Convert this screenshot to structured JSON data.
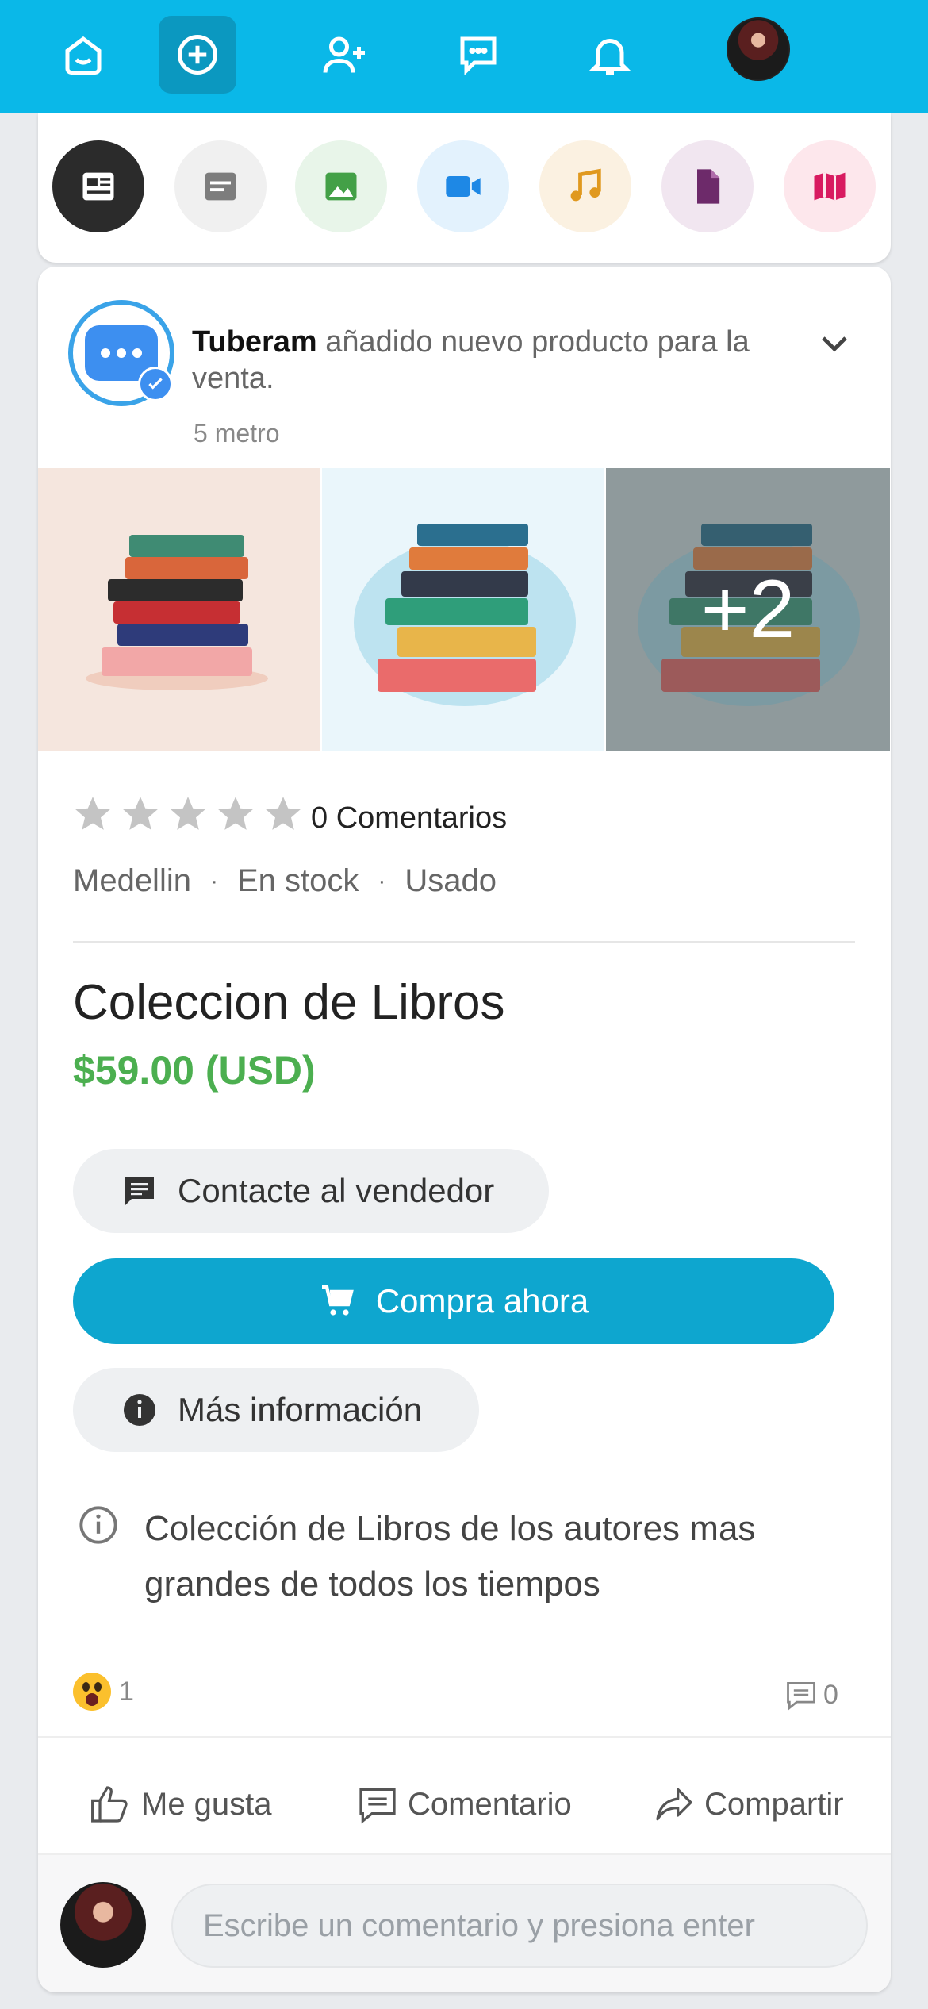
{
  "colors": {
    "topbar": "#0ab8e8",
    "accent": "#0ea6cf",
    "price": "#4caf50"
  },
  "nav": {
    "items": [
      "home-icon",
      "add-post-icon",
      "add-friend-icon",
      "messages-icon",
      "notifications-icon"
    ],
    "active": "add-post-icon"
  },
  "post_types": [
    "news-feed-icon",
    "text-post-icon",
    "image-icon",
    "video-icon",
    "music-icon",
    "document-icon",
    "map-icon"
  ],
  "post": {
    "author": "Tuberam",
    "action_text": " añadido nuevo producto para la venta.",
    "time": "5 metro",
    "more_images": "+2",
    "rating": {
      "stars": 0,
      "max": 5
    },
    "reviews_label": "0 Comentarios",
    "location": "Medellin",
    "stock": "En stock",
    "condition": "Usado",
    "separator": "·",
    "title": "Coleccion de Libros",
    "price": "$59.00 (USD)",
    "contact_label": "Contacte al vendedor",
    "buy_label": "Compra ahora",
    "info_label": "Más información",
    "description": "Colección de Libros de los autores mas grandes de todos los tiempos",
    "reaction_count": "1",
    "comment_count": "0",
    "actions": {
      "like": "Me gusta",
      "comment": "Comentario",
      "share": "Compartir"
    },
    "comment_placeholder": "Escribe un comentario y presiona enter"
  }
}
